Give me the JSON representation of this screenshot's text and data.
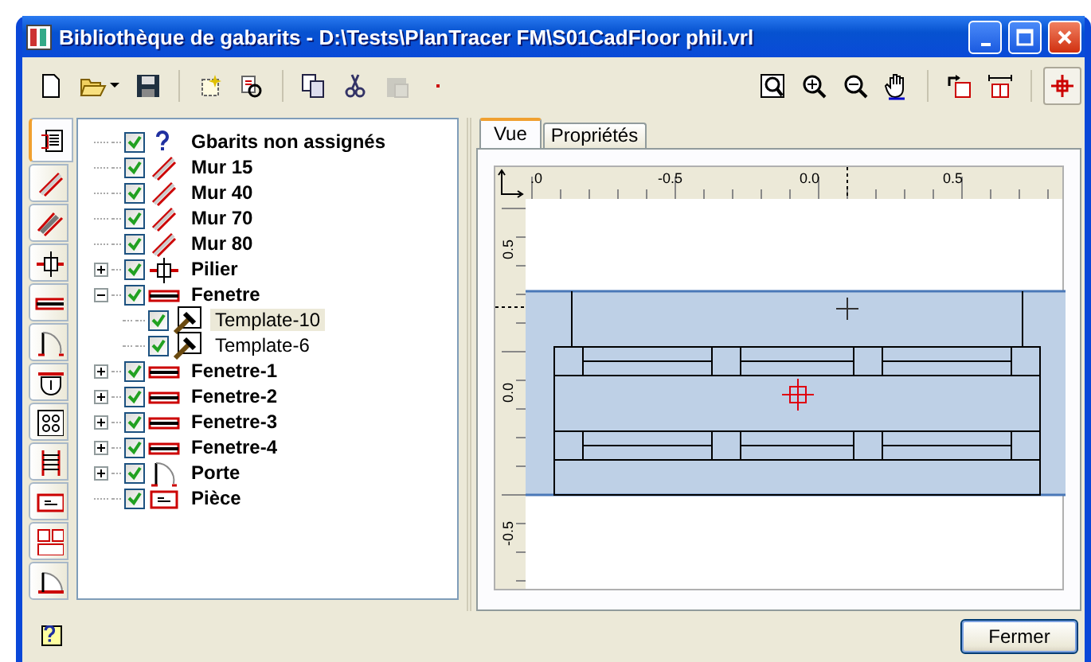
{
  "window": {
    "title": "Bibliothèque de gabarits - D:\\Tests\\PlanTracer FM\\S01CadFloor phil.vrl"
  },
  "toolbar": {
    "left": [
      {
        "kind": "new",
        "pressed": false,
        "disabled": false
      },
      {
        "kind": "open",
        "pressed": false,
        "disabled": false
      },
      {
        "kind": "save",
        "pressed": false,
        "disabled": false
      },
      {
        "kind": "separator"
      },
      {
        "kind": "new-template",
        "pressed": false,
        "disabled": false
      },
      {
        "kind": "find",
        "pressed": false,
        "disabled": false
      },
      {
        "kind": "separator"
      },
      {
        "kind": "copy",
        "pressed": false,
        "disabled": false
      },
      {
        "kind": "cut",
        "pressed": false,
        "disabled": false
      },
      {
        "kind": "paste",
        "pressed": false,
        "disabled": true
      },
      {
        "kind": "dot",
        "pressed": false,
        "disabled": false
      }
    ],
    "right": [
      {
        "kind": "zoom-fit",
        "pressed": false,
        "disabled": false
      },
      {
        "kind": "zoom-in",
        "pressed": false,
        "disabled": false
      },
      {
        "kind": "zoom-out",
        "pressed": false,
        "disabled": false
      },
      {
        "kind": "pan",
        "pressed": false,
        "disabled": false
      },
      {
        "kind": "separator"
      },
      {
        "kind": "rotate",
        "pressed": false,
        "disabled": false
      },
      {
        "kind": "flip",
        "pressed": false,
        "disabled": false
      },
      {
        "kind": "separator"
      },
      {
        "kind": "crosshair",
        "pressed": true,
        "disabled": false
      }
    ]
  },
  "side_tabs": [
    {
      "kind": "document",
      "selected": true
    },
    {
      "kind": "wall",
      "selected": false
    },
    {
      "kind": "wall-double",
      "selected": false
    },
    {
      "kind": "pillar",
      "selected": false
    },
    {
      "kind": "window",
      "selected": false
    },
    {
      "kind": "door",
      "selected": false
    },
    {
      "kind": "fixture",
      "selected": false
    },
    {
      "kind": "grid",
      "selected": false
    },
    {
      "kind": "ladder",
      "selected": false
    },
    {
      "kind": "room",
      "selected": false
    },
    {
      "kind": "rooms",
      "selected": false
    },
    {
      "kind": "stairs",
      "selected": false
    }
  ],
  "tree": [
    {
      "label": "Gbarits non assignés",
      "kind": "question",
      "checked": true,
      "selected": false
    },
    {
      "label": "Mur 15",
      "kind": "wall",
      "checked": true,
      "selected": false
    },
    {
      "label": "Mur 40",
      "kind": "wall",
      "checked": true,
      "selected": false
    },
    {
      "label": "Mur 70",
      "kind": "wall",
      "checked": true,
      "selected": false
    },
    {
      "label": "Mur 80",
      "kind": "wall",
      "checked": true,
      "selected": false
    },
    {
      "label": "Pilier",
      "kind": "pillar",
      "checked": true,
      "selected": false,
      "expanded": false
    },
    {
      "label": "Fenetre",
      "kind": "window",
      "checked": true,
      "selected": false,
      "expanded": true,
      "children": [
        {
          "label": "Template-10",
          "kind": "template",
          "checked": true,
          "selected": true
        },
        {
          "label": "Template-6",
          "kind": "template",
          "checked": true,
          "selected": false
        }
      ]
    },
    {
      "label": "Fenetre-1",
      "kind": "window",
      "checked": true,
      "selected": false,
      "expanded": false
    },
    {
      "label": "Fenetre-2",
      "kind": "window",
      "checked": true,
      "selected": false,
      "expanded": false
    },
    {
      "label": "Fenetre-3",
      "kind": "window",
      "checked": true,
      "selected": false,
      "expanded": false
    },
    {
      "label": "Fenetre-4",
      "kind": "window",
      "checked": true,
      "selected": false,
      "expanded": false
    },
    {
      "label": "Porte",
      "kind": "door",
      "checked": true,
      "selected": false,
      "expanded": false
    },
    {
      "label": "Pièce",
      "kind": "room",
      "checked": true,
      "selected": false
    }
  ],
  "view_tabs": [
    {
      "label": "Vue",
      "selected": true
    },
    {
      "label": "Propriétés",
      "selected": false
    }
  ],
  "ruler": {
    "x_labels": [
      ".0",
      "-0.5",
      "0.0",
      "0.5"
    ],
    "y_labels": [
      "0.5",
      "0.0",
      "-0.5"
    ]
  },
  "buttons": [
    "Fermer"
  ]
}
